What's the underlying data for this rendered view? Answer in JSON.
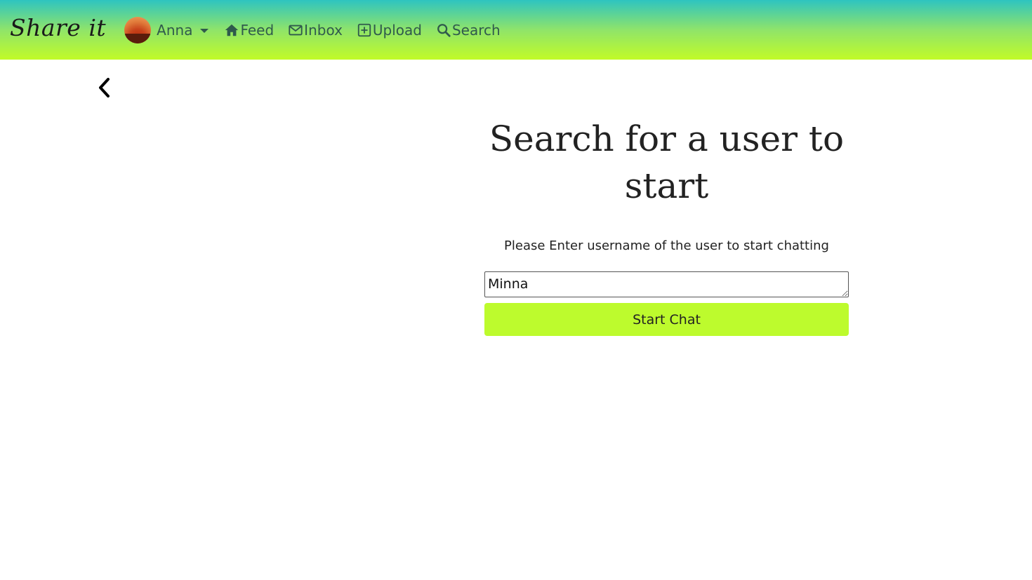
{
  "navbar": {
    "brand": "Share it",
    "user": {
      "name": "Anna",
      "avatar_icon": "user-avatar"
    },
    "links": [
      {
        "label": "Feed",
        "icon": "home-icon"
      },
      {
        "label": "Inbox",
        "icon": "envelope-icon"
      },
      {
        "label": "Upload",
        "icon": "plus-square-icon"
      },
      {
        "label": "Search",
        "icon": "search-icon"
      }
    ],
    "gradient_colors": [
      "#2ec4c0",
      "#c2fb27"
    ]
  },
  "back_button": {
    "icon": "chevron-left-icon"
  },
  "main": {
    "title": "Search for a user to start",
    "instruction": "Please Enter username of the user to start chatting",
    "username_value": "Minna",
    "start_button_label": "Start Chat",
    "button_color": "#bdfb2d"
  }
}
